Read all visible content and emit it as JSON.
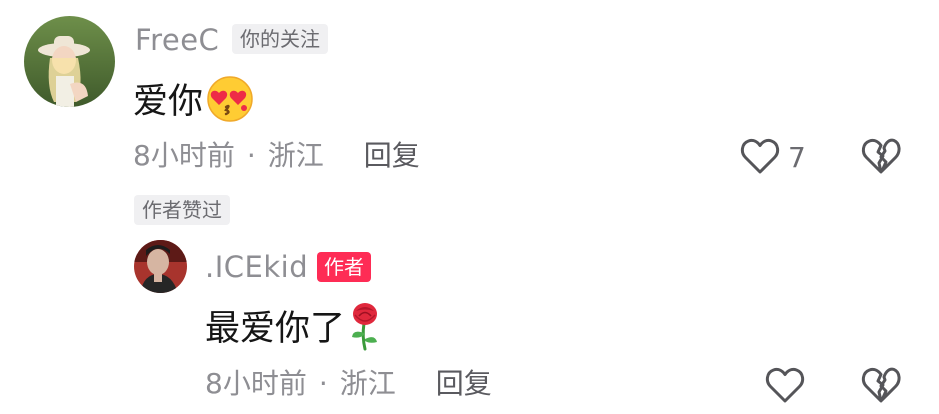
{
  "comment": {
    "username": "FreeC",
    "relation_tag": "你的关注",
    "text": "爱你",
    "emoji": "heart-eyes-kiss-emoji",
    "time": "8小时前",
    "separator": "·",
    "location": "浙江",
    "reply_label": "回复",
    "like_count": "7",
    "author_liked_tag": "作者赞过"
  },
  "reply": {
    "username": ".ICEkid",
    "author_tag": "作者",
    "text": "最爱你了",
    "emoji": "rose-emoji",
    "time": "8小时前",
    "separator": "·",
    "location": "浙江",
    "reply_label": "回复"
  },
  "colors": {
    "author_tag": "#fe2c55",
    "secondary_text": "#8e8e93",
    "primary_text": "#161616"
  }
}
